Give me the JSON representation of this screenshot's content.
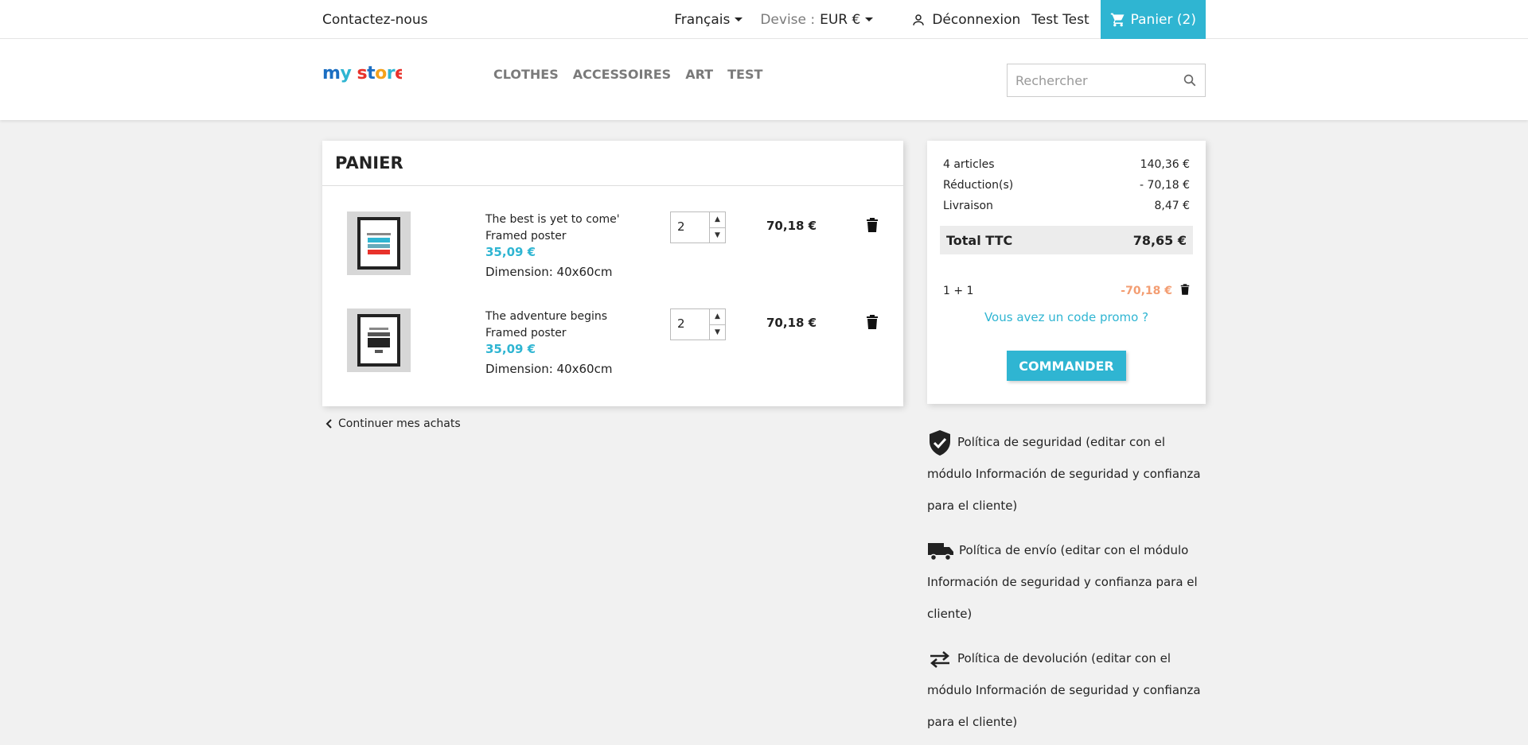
{
  "topbar": {
    "contact": "Contactez-nous",
    "language": "Français",
    "currency_label": "Devise :",
    "currency_value": "EUR €",
    "logout": "Déconnexion",
    "user_name": "Test Test",
    "cart": "Panier (2)"
  },
  "header": {
    "logo": "my store",
    "menu": [
      "CLOTHES",
      "ACCESSOIRES",
      "ART",
      "TEST"
    ],
    "search_placeholder": "Rechercher"
  },
  "cart": {
    "title": "PANIER",
    "items": [
      {
        "name": "The best is yet to come' Framed poster",
        "price": "35,09 €",
        "dimension": "Dimension: 40x60cm",
        "quantity": "2",
        "total": "70,18 €"
      },
      {
        "name": "The adventure begins Framed poster",
        "price": "35,09 €",
        "dimension": "Dimension: 40x60cm",
        "quantity": "2",
        "total": "70,18 €"
      }
    ],
    "continue": "Continuer mes achats"
  },
  "summary": {
    "articles_label": "4 articles",
    "articles_value": "140,36 €",
    "reduction_label": "Réduction(s)",
    "reduction_value": "- 70,18 €",
    "shipping_label": "Livraison",
    "shipping_value": "8,47 €",
    "total_label": "Total TTC",
    "total_value": "78,65 €",
    "voucher_name": "1 + 1",
    "voucher_value": "-70,18 €",
    "promo_link": "Vous avez un code promo ?",
    "order_button": "COMMANDER"
  },
  "reassurance": [
    {
      "icon": "shield-check-icon",
      "text": "Política de seguridad (editar con el módulo Información de seguridad y confianza para el cliente)"
    },
    {
      "icon": "truck-icon",
      "text": "Política de envío (editar con el módulo Información de seguridad y confianza para el cliente)"
    },
    {
      "icon": "swap-arrows-icon",
      "text": "Política de devolución (editar con el módulo Información de seguridad y confianza para el cliente)"
    }
  ],
  "colors": {
    "accent": "#2fb5d2",
    "discount": "#f39d72",
    "background": "#f1f1f1"
  }
}
